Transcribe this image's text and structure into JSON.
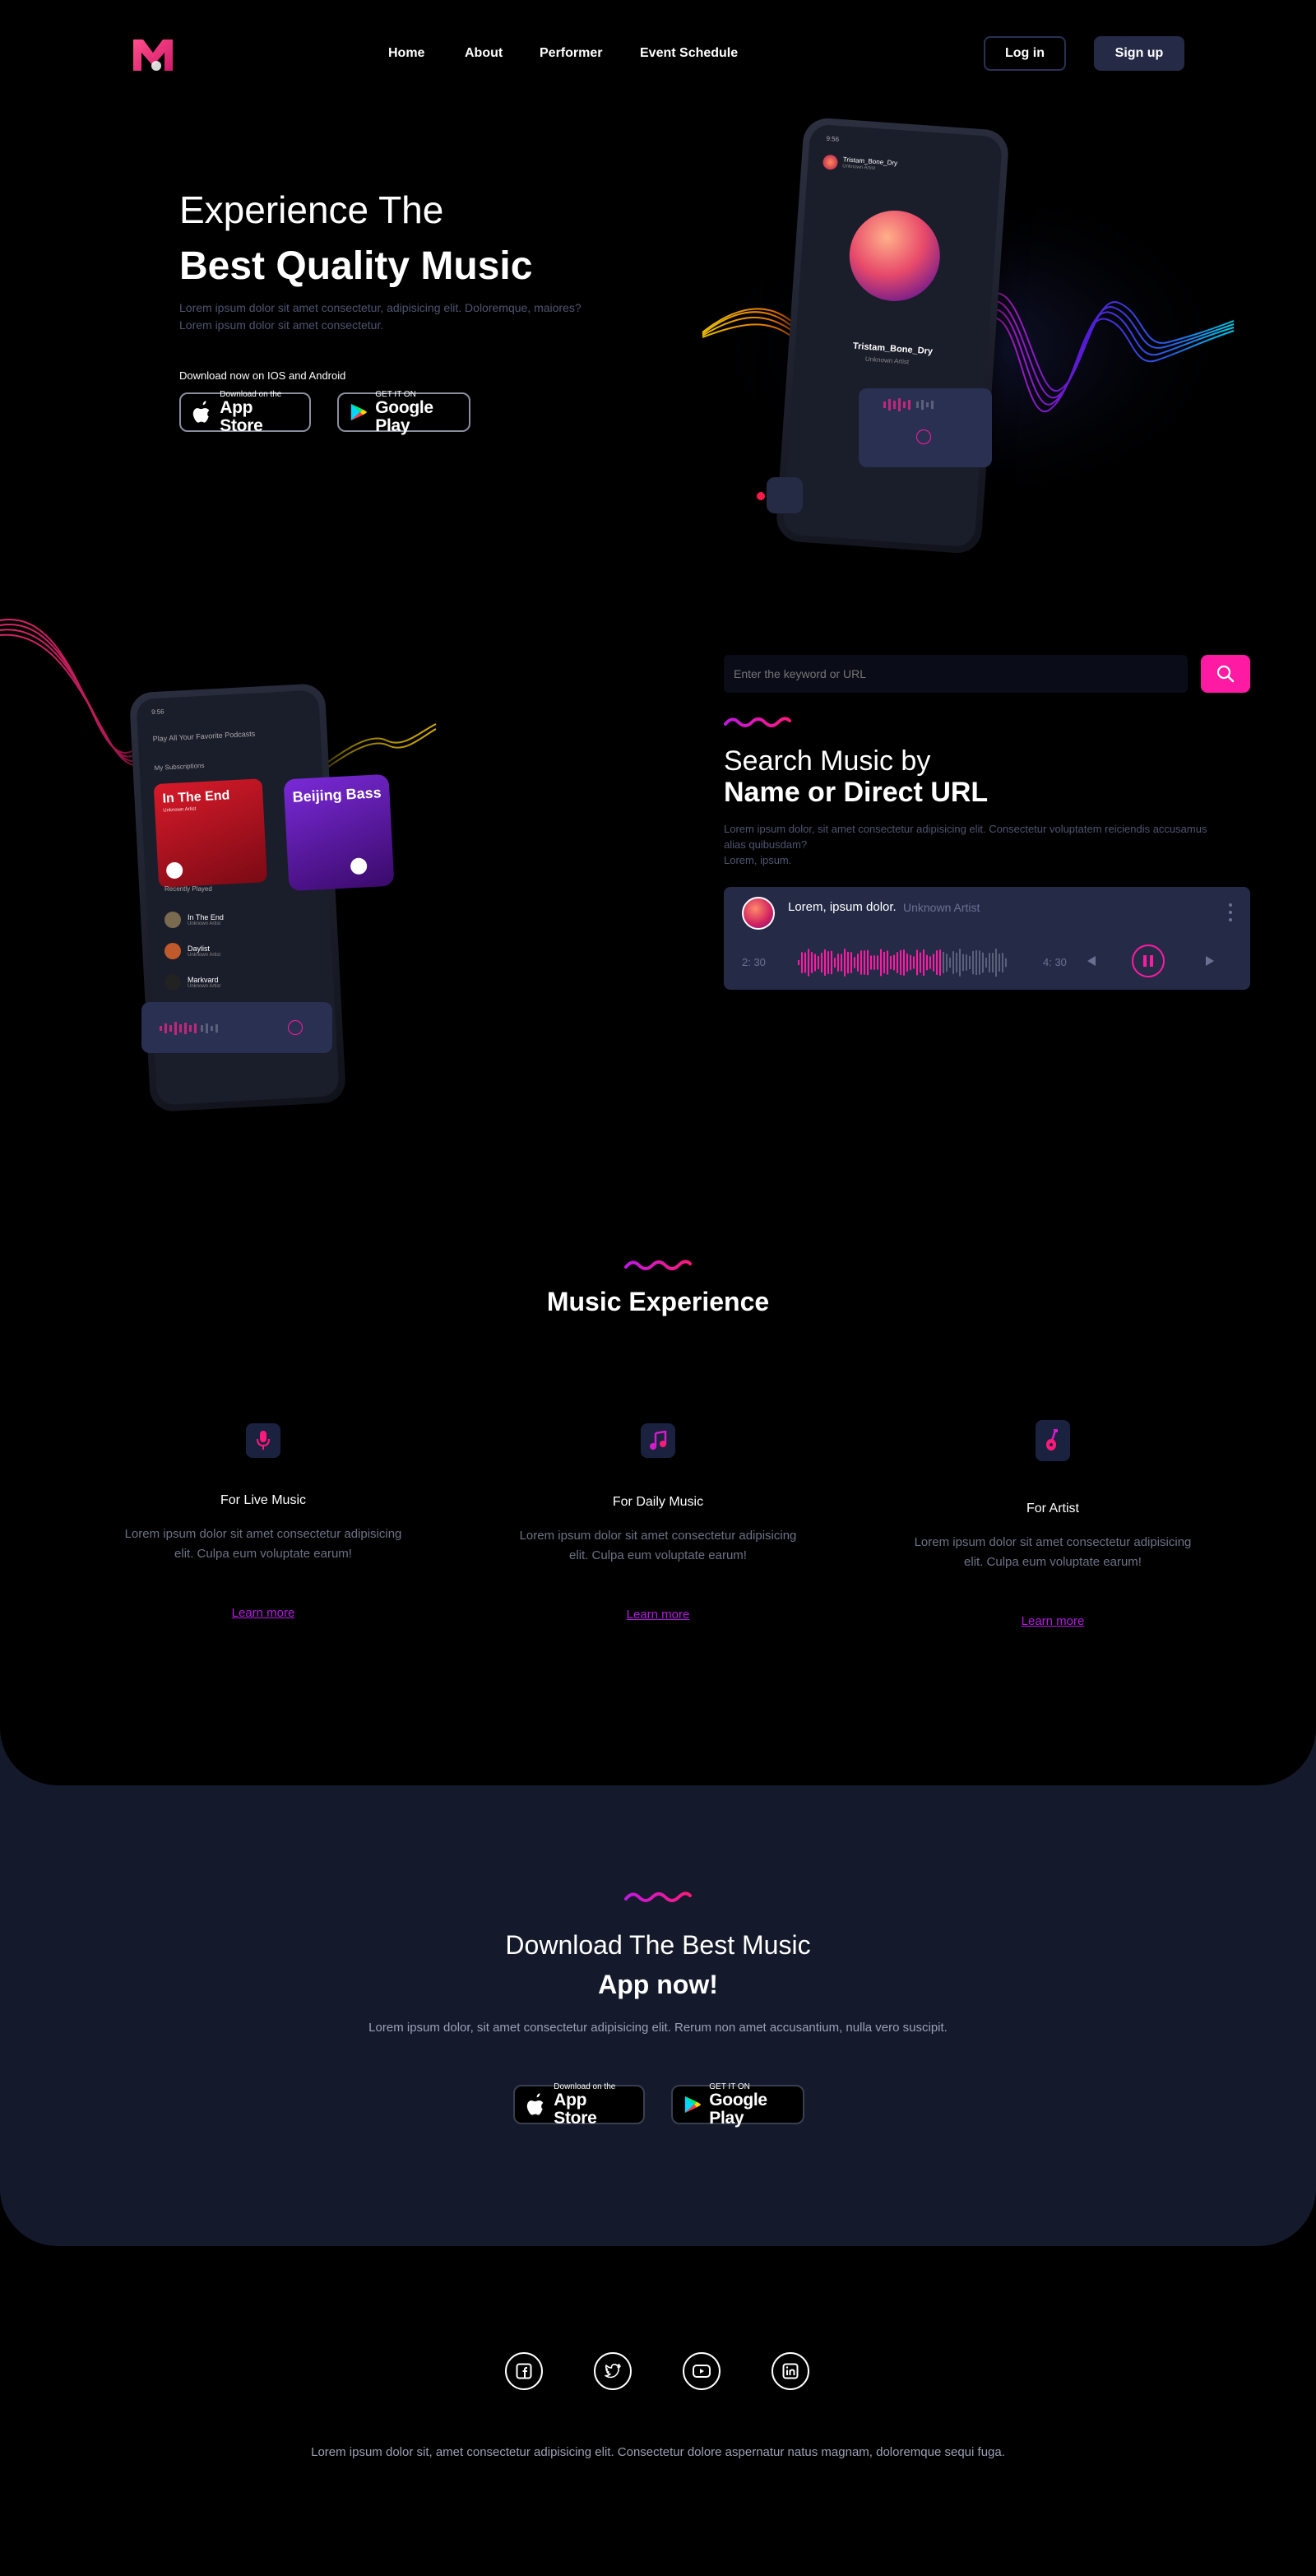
{
  "nav": {
    "links": [
      "Home",
      "About",
      "Performer",
      "Event Schedule"
    ],
    "login": "Log in",
    "signup": "Sign up"
  },
  "hero": {
    "title_line1": "Experience The",
    "title_line2": "Best Quality Music",
    "subtitle_line1": "Lorem ipsum dolor sit amet consectetur, adipisicing elit. Doloremque, maiores?",
    "subtitle_line2": "Lorem ipsum dolor sit amet consectetur.",
    "download_label": "Download now on IOS and Android",
    "phone": {
      "time": "9:56",
      "track": "Tristam_Bone_Dry",
      "artist": "Unknown Artist"
    }
  },
  "stores": {
    "apple_small": "Download on the",
    "apple_big": "App Store",
    "google_small": "GET IT ON",
    "google_big": "Google Play"
  },
  "search": {
    "placeholder": "Enter the keyword or URL",
    "title_line1": "Search Music by",
    "title_line2": "Name or Direct URL",
    "desc_line1": "Lorem ipsum dolor, sit amet consectetur adipisicing elit. Consectetur voluptatem reiciendis accusamus",
    "desc_line2": "alias quibusdam?",
    "desc_line3": "Lorem, ipsum."
  },
  "player": {
    "title": "Lorem, ipsum dolor.",
    "artist": "Unknown Artist",
    "current_time": "2: 30",
    "total_time": "4: 30"
  },
  "podcast_phone": {
    "time": "9:56",
    "heading": "Play All Your Favorite Podcasts",
    "subscriptions": "My Subscriptions",
    "card1_title": "In The End",
    "card1_sub": "Unknown Artist",
    "card2_title": "Beijing Bass",
    "recent": "Recently Played",
    "tracks": [
      {
        "title": "In The End",
        "artist": "Unknown Artist"
      },
      {
        "title": "Daylist",
        "artist": "Unknown Artist"
      },
      {
        "title": "Markvard",
        "artist": "Unknown Artist"
      }
    ]
  },
  "experience": {
    "title": "Music Experience",
    "features": [
      {
        "icon": "microphone-icon",
        "title": "For Live Music",
        "text_line1": "Lorem ipsum dolor sit amet consectetur adipisicing",
        "text_line2": "elit. Culpa eum voluptate earum!",
        "link": "Learn more"
      },
      {
        "icon": "music-note-icon",
        "title": "For Daily Music",
        "text_line1": "Lorem ipsum dolor sit amet consectetur adipisicing",
        "text_line2": "elit. Culpa eum voluptate earum!",
        "link": "Learn more"
      },
      {
        "icon": "guitar-icon",
        "title": "For Artist",
        "text_line1": "Lorem ipsum dolor sit amet consectetur adipisicing",
        "text_line2": "elit. Culpa eum voluptate earum!",
        "link": "Learn more"
      }
    ]
  },
  "download": {
    "title_line1": "Download The Best Music",
    "title_line2": "App now!",
    "text": "Lorem ipsum dolor, sit amet consectetur adipisicing elit. Rerum non amet accusantium, nulla vero suscipit."
  },
  "footer": {
    "socials": [
      "facebook-icon",
      "twitter-icon",
      "youtube-icon",
      "linkedin-icon"
    ],
    "text": "Lorem ipsum dolor sit, amet consectetur adipisicing elit. Consectetur dolore aspernatur natus magnam, doloremque sequi fuga."
  },
  "colors": {
    "accent": "#ff1aa3",
    "purple": "#b41ce0",
    "panel": "#252b47",
    "section_bg": "#141a2b"
  }
}
